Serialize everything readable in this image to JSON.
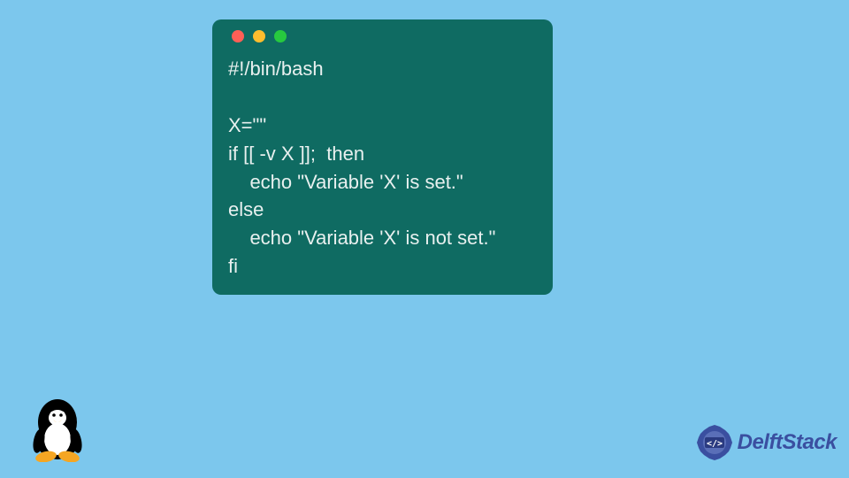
{
  "code_window": {
    "dots": [
      "red",
      "yellow",
      "green"
    ],
    "lines": [
      "#!/bin/bash",
      "",
      "X=\"\"",
      "if [[ -v X ]];  then",
      "    echo \"Variable 'X' is set.\"",
      "else",
      "    echo \"Variable 'X' is not set.\"",
      "fi"
    ]
  },
  "brand": {
    "name": "DelftStack"
  },
  "icons": {
    "tux": "tux-penguin",
    "delft_badge": "code-brackets-badge"
  }
}
